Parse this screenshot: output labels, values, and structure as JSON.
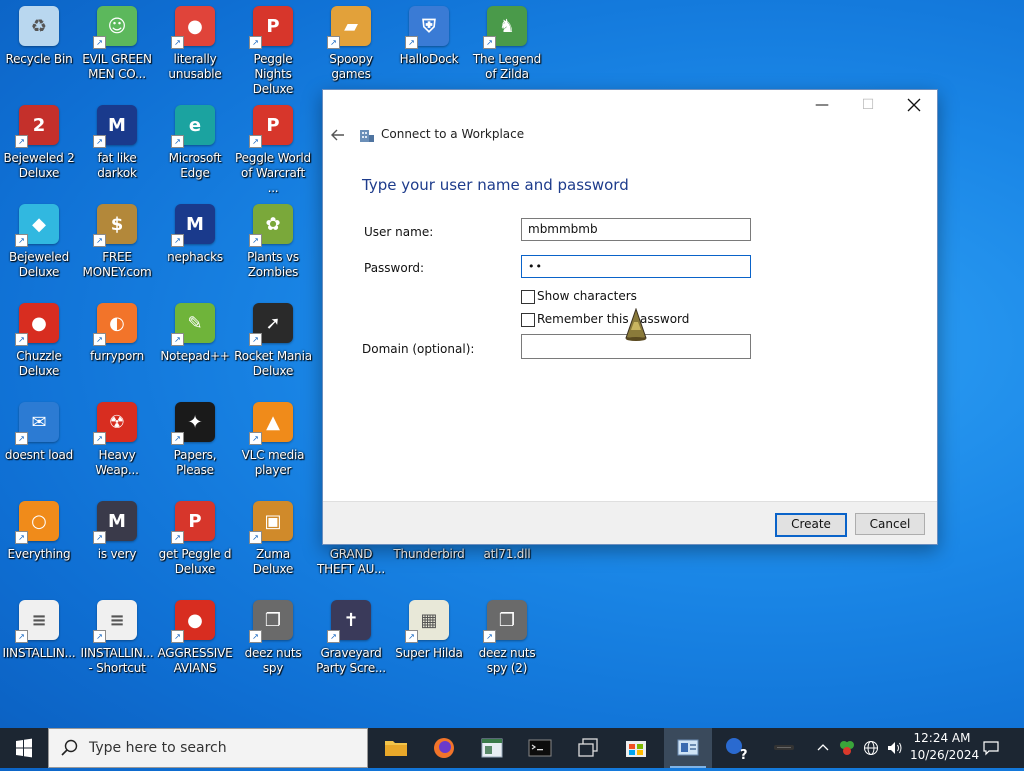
{
  "desktop": {
    "icons": [
      {
        "label": "Recycle Bin",
        "icon": "recycle-bin-icon",
        "color": "#b9d7ef"
      },
      {
        "label": "EVIL GREEN MEN CO...",
        "icon": "messenger-icon",
        "color": "#5cb85c"
      },
      {
        "label": "literally unusable",
        "icon": "chrome-icon",
        "color": "#e0443a"
      },
      {
        "label": "Peggle Nights Deluxe",
        "icon": "peggle-icon",
        "color": "#d7362b"
      },
      {
        "label": "Spoopy games",
        "icon": "folder-icon",
        "color": "#e2a13a"
      },
      {
        "label": "HalloDock",
        "icon": "shield-icon",
        "color": "#3a7bd5"
      },
      {
        "label": "The Legend of Zilda",
        "icon": "zelda-icon",
        "color": "#4a9a4a"
      },
      {
        "label": "Bejeweled 2 Deluxe",
        "icon": "bejeweled-icon",
        "color": "#c4302b"
      },
      {
        "label": "fat like darkok",
        "icon": "mpi-icon",
        "color": "#1a3a8c"
      },
      {
        "label": "Microsoft Edge",
        "icon": "edge-icon",
        "color": "#1ba3a0"
      },
      {
        "label": "Peggle World of Warcraft ...",
        "icon": "peggle-icon",
        "color": "#d7362b"
      },
      {
        "label": "Bejeweled Deluxe",
        "icon": "diamond-icon",
        "color": "#31b8e0"
      },
      {
        "label": "FREE MONEY.com",
        "icon": "money-bag-icon",
        "color": "#b3883a"
      },
      {
        "label": "nephacks",
        "icon": "mpi-icon",
        "color": "#1a3a8c"
      },
      {
        "label": "Plants vs Zombies",
        "icon": "flower-icon",
        "color": "#7aa83a"
      },
      {
        "label": "Chuzzle Deluxe",
        "icon": "chuzzle-icon",
        "color": "#d82d20"
      },
      {
        "label": "furryporn",
        "icon": "firefox-icon",
        "color": "#f2742a"
      },
      {
        "label": "Notepad++",
        "icon": "notepad-icon",
        "color": "#6fb43a"
      },
      {
        "label": "Rocket Mania Deluxe",
        "icon": "rocket-icon",
        "color": "#2a2a2a"
      },
      {
        "label": "doesnt load",
        "icon": "thunderbird-icon",
        "color": "#2c7bd3"
      },
      {
        "label": "Heavy Weap...",
        "icon": "radiation-icon",
        "color": "#d82d20"
      },
      {
        "label": "Papers, Please",
        "icon": "papers-icon",
        "color": "#1a1a1a"
      },
      {
        "label": "VLC media player",
        "icon": "vlc-icon",
        "color": "#f08b1a"
      },
      {
        "label": "Everything",
        "icon": "search-icon",
        "color": "#f08b1a"
      },
      {
        "label": "is very",
        "icon": "mpi-icon",
        "color": "#3a3a4a"
      },
      {
        "label": "get Peggle d Deluxe",
        "icon": "peggle-icon",
        "color": "#d7362b"
      },
      {
        "label": "Zuma Deluxe",
        "icon": "zuma-icon",
        "color": "#d08a2a"
      },
      {
        "label": "GRAND THEFT AU...",
        "icon": "gta-icon",
        "color": "#2a2a2a"
      },
      {
        "label": "Thunderbird",
        "icon": "thunderbird-icon",
        "color": "#2c7bd3"
      },
      {
        "label": "atl71.dll",
        "icon": "dll-icon",
        "color": "#c9c9c9"
      },
      {
        "label": "IINSTALLIN...",
        "icon": "document-icon",
        "color": "#f0f0f0"
      },
      {
        "label": "IINSTALLIN... - Shortcut",
        "icon": "document-icon",
        "color": "#f0f0f0"
      },
      {
        "label": "AGGRESSIVE AVIANS",
        "icon": "angry-bird-icon",
        "color": "#d82d20"
      },
      {
        "label": "deez nuts spy",
        "icon": "stacked-windows-icon",
        "color": "#6a6a6a"
      },
      {
        "label": "Graveyard Party Scre...",
        "icon": "graveyard-icon",
        "color": "#3a3a5a"
      },
      {
        "label": "Super Hilda",
        "icon": "pixel-art-icon",
        "color": "#e8e8d8"
      },
      {
        "label": "deez nuts spy (2)",
        "icon": "stacked-windows-icon",
        "color": "#6a6a6a"
      }
    ]
  },
  "dialog": {
    "title": "Connect to a Workplace",
    "heading": "Type your user name and password",
    "username_label": "User name:",
    "username_value": "mbmmbmb",
    "password_label": "Password:",
    "password_value": "••",
    "show_characters_label": "Show characters",
    "remember_label": "Remember this password",
    "domain_label": "Domain (optional):",
    "domain_value": "",
    "create_label": "Create",
    "cancel_label": "Cancel"
  },
  "taskbar": {
    "search_placeholder": "Type here to search",
    "time": "12:24 AM",
    "date": "10/26/2024"
  },
  "colors": {
    "accent": "#0a63c9",
    "heading": "#1e3c8c",
    "taskbar": "#1c2632"
  }
}
